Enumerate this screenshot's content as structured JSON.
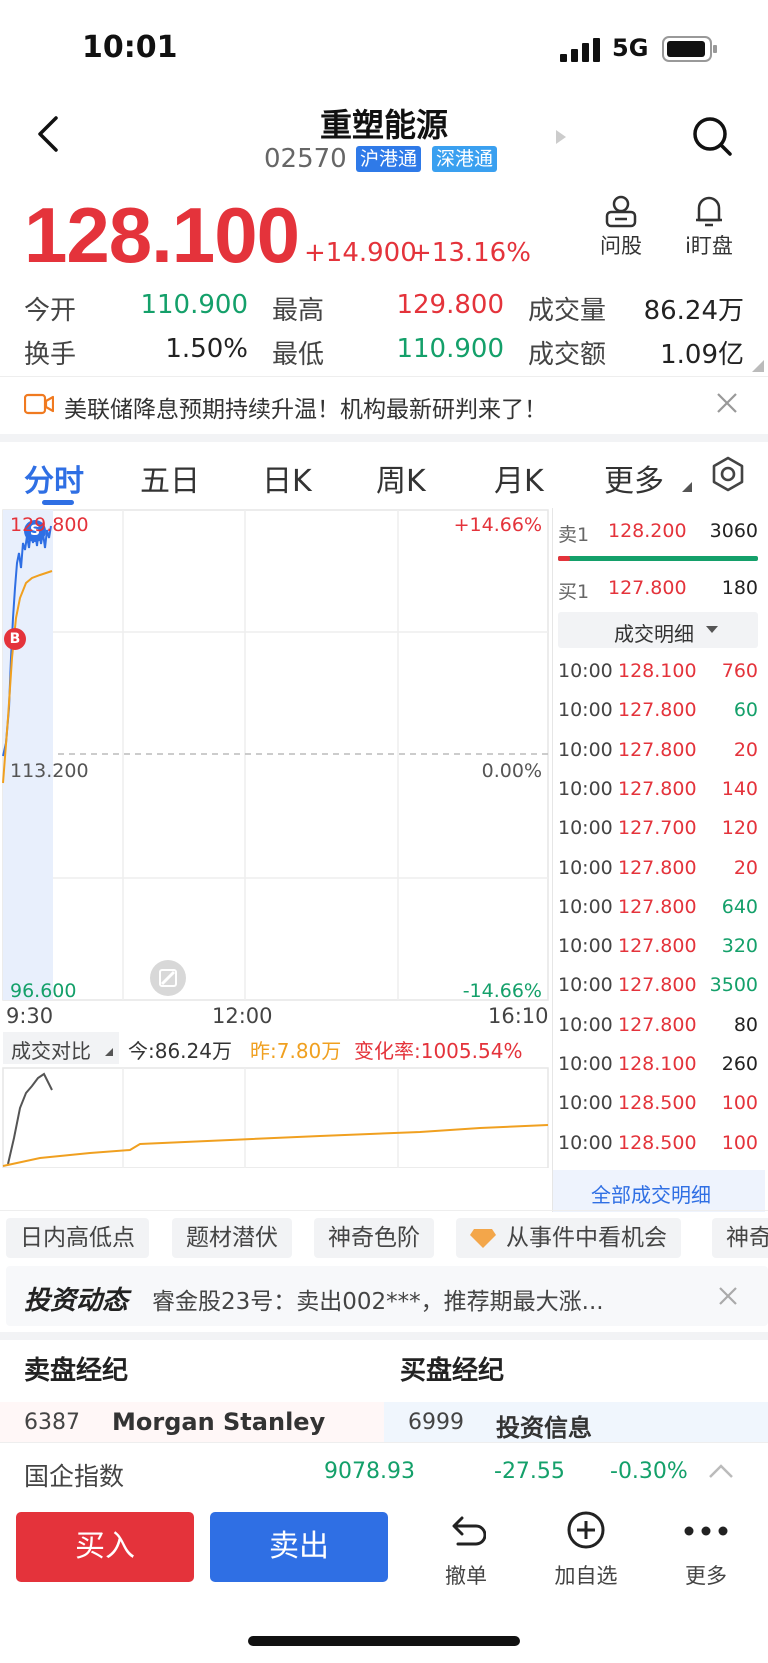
{
  "status": {
    "time": "10:01",
    "network": "5G"
  },
  "header": {
    "title": "重塑能源",
    "code": "02570",
    "tags": [
      "沪港通",
      "深港通"
    ],
    "ask_label": "问股",
    "watch_label": "i盯盘"
  },
  "quote": {
    "price": "128.100",
    "change": "+14.900",
    "change_pct": "+13.16%"
  },
  "stats": {
    "open_label": "今开",
    "open": "110.900",
    "high_label": "最高",
    "high": "129.800",
    "volume_label": "成交量",
    "volume": "86.24万",
    "turnover_label": "换手",
    "turnover": "1.50%",
    "low_label": "最低",
    "low": "110.900",
    "amount_label": "成交额",
    "amount": "1.09亿"
  },
  "banner": {
    "text": "美联储降息预期持续升温！机构最新研判来了！"
  },
  "tabs": [
    "分时",
    "五日",
    "日K",
    "周K",
    "月K",
    "更多"
  ],
  "chart": {
    "top_price": "129.800",
    "mid_price": "113.200",
    "bottom_price": "96.600",
    "top_pct": "+14.66%",
    "mid_pct": "0.00%",
    "bottom_pct": "-14.66%",
    "time_start": "9:30",
    "time_mid": "12:00",
    "time_end": "16:10",
    "buy_marker": "B",
    "sell_marker": "S"
  },
  "volume_compare": {
    "label": "成交对比",
    "today": "今:86.24万",
    "yesterday": "昨:7.80万",
    "change_rate": "变化率:1005.54%"
  },
  "order_book": {
    "ask_label": "卖1",
    "ask_price": "128.200",
    "ask_vol": "3060",
    "bid_label": "买1",
    "bid_price": "127.800",
    "bid_vol": "180",
    "detail_button": "成交明细",
    "all_detail": "全部成交明细",
    "ticks": [
      {
        "time": "10:00",
        "price": "128.100",
        "vol": "760",
        "dir": "red"
      },
      {
        "time": "10:00",
        "price": "127.800",
        "vol": "60",
        "dir": "green"
      },
      {
        "time": "10:00",
        "price": "127.800",
        "vol": "20",
        "dir": "red"
      },
      {
        "time": "10:00",
        "price": "127.800",
        "vol": "140",
        "dir": "red"
      },
      {
        "time": "10:00",
        "price": "127.700",
        "vol": "120",
        "dir": "red"
      },
      {
        "time": "10:00",
        "price": "127.800",
        "vol": "20",
        "dir": "red"
      },
      {
        "time": "10:00",
        "price": "127.800",
        "vol": "640",
        "dir": "green"
      },
      {
        "time": "10:00",
        "price": "127.800",
        "vol": "320",
        "dir": "green"
      },
      {
        "time": "10:00",
        "price": "127.800",
        "vol": "3500",
        "dir": "green"
      },
      {
        "time": "10:00",
        "price": "127.800",
        "vol": "80",
        "dir": "black"
      },
      {
        "time": "10:00",
        "price": "128.100",
        "vol": "260",
        "dir": "black"
      },
      {
        "time": "10:00",
        "price": "128.500",
        "vol": "100",
        "dir": "red"
      },
      {
        "time": "10:00",
        "price": "128.500",
        "vol": "100",
        "dir": "red"
      }
    ]
  },
  "chips": [
    "日内高低点",
    "题材潜伏",
    "神奇色阶",
    "从事件中看机会",
    "神奇"
  ],
  "invest": {
    "title": "投资动态",
    "text": "睿金股23号：卖出002***，推荐期最大涨..."
  },
  "brokers": {
    "sell_title": "卖盘经纪",
    "buy_title": "买盘经纪",
    "sell_code": "6387",
    "sell_name": "Morgan Stanley",
    "buy_code": "6999",
    "buy_name": "投资信息"
  },
  "index_bar": {
    "name": "国企指数",
    "value": "9078.93",
    "change": "-27.55",
    "change_pct": "-0.30%"
  },
  "bottom": {
    "buy": "买入",
    "sell": "卖出",
    "cancel": "撤单",
    "add_watch": "加自选",
    "more": "更多"
  },
  "colors": {
    "red": "#e4333b",
    "green": "#14a06a",
    "blue": "#2f6fe4",
    "orange": "#f0a020"
  }
}
